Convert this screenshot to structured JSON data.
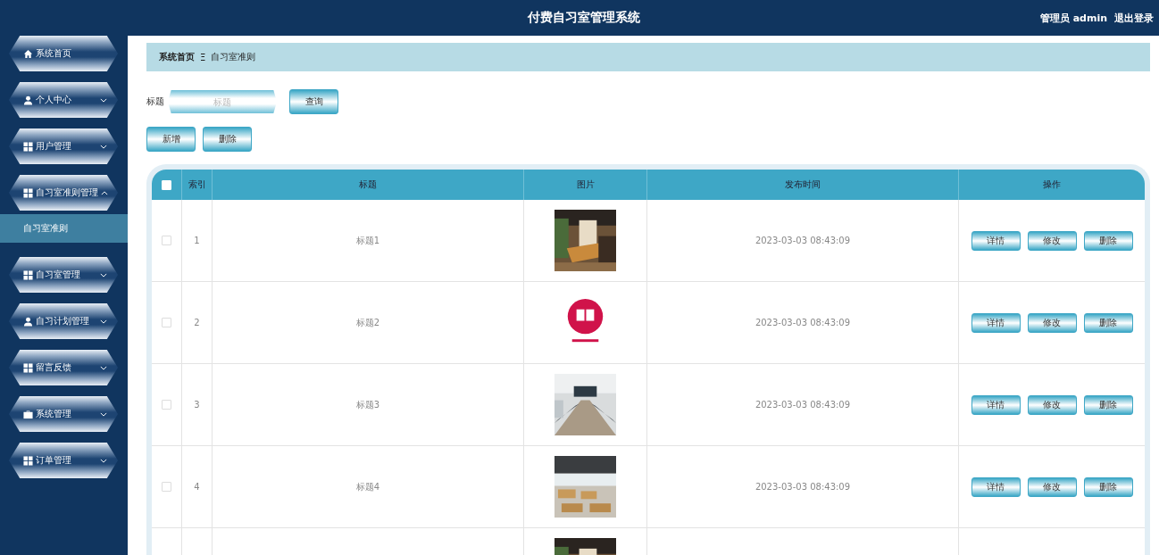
{
  "header": {
    "title": "付费自习室管理系统",
    "user": "管理员 admin",
    "logout": "退出登录"
  },
  "sidebar": {
    "items": [
      {
        "label": "系统首页",
        "kind": "home"
      },
      {
        "label": "个人中心",
        "kind": "user",
        "expanded": false
      },
      {
        "label": "用户管理",
        "kind": "grid",
        "expanded": false
      },
      {
        "label": "自习室准则管理",
        "kind": "grid",
        "expanded": true,
        "children": [
          {
            "label": "自习室准则",
            "selected": true
          }
        ]
      },
      {
        "label": "自习室管理",
        "kind": "grid",
        "expanded": false
      },
      {
        "label": "自习计划管理",
        "kind": "user",
        "expanded": false
      },
      {
        "label": "留言反馈",
        "kind": "grid",
        "expanded": false
      },
      {
        "label": "系统管理",
        "kind": "case",
        "expanded": false
      },
      {
        "label": "订单管理",
        "kind": "grid",
        "expanded": false
      }
    ]
  },
  "breadcrumb": {
    "home": "系统首页",
    "separator": "Ξ",
    "current": "自习室准则"
  },
  "search": {
    "label": "标题",
    "placeholder": "标题",
    "button": "查询"
  },
  "actions": [
    "新增",
    "删除"
  ],
  "table": {
    "columns": [
      "索引",
      "标题",
      "图片",
      "发布时间",
      "操作"
    ],
    "all_checked": false,
    "rows": [
      {
        "checked": false,
        "index": "1",
        "title": "标题1",
        "image": {
          "kind": "picture"
        },
        "time": "2023-03-03 08:43:09",
        "buttons": [
          "详情",
          "修改",
          "删除"
        ]
      },
      {
        "checked": false,
        "index": "2",
        "title": "标题2",
        "image": {
          "kind": "picture"
        },
        "time": "2023-03-03 08:43:09",
        "buttons": [
          "详情",
          "修改",
          "删除"
        ]
      },
      {
        "checked": false,
        "index": "3",
        "title": "标题3",
        "image": {
          "kind": "picture"
        },
        "time": "2023-03-03 08:43:09",
        "buttons": [
          "详情",
          "修改",
          "删除"
        ]
      },
      {
        "checked": false,
        "index": "4",
        "title": "标题4",
        "image": {
          "kind": "picture"
        },
        "time": "2023-03-03 08:43:09",
        "buttons": [
          "详情",
          "修改",
          "删除"
        ]
      },
      {
        "image": {
          "kind": "picture"
        }
      }
    ]
  }
}
